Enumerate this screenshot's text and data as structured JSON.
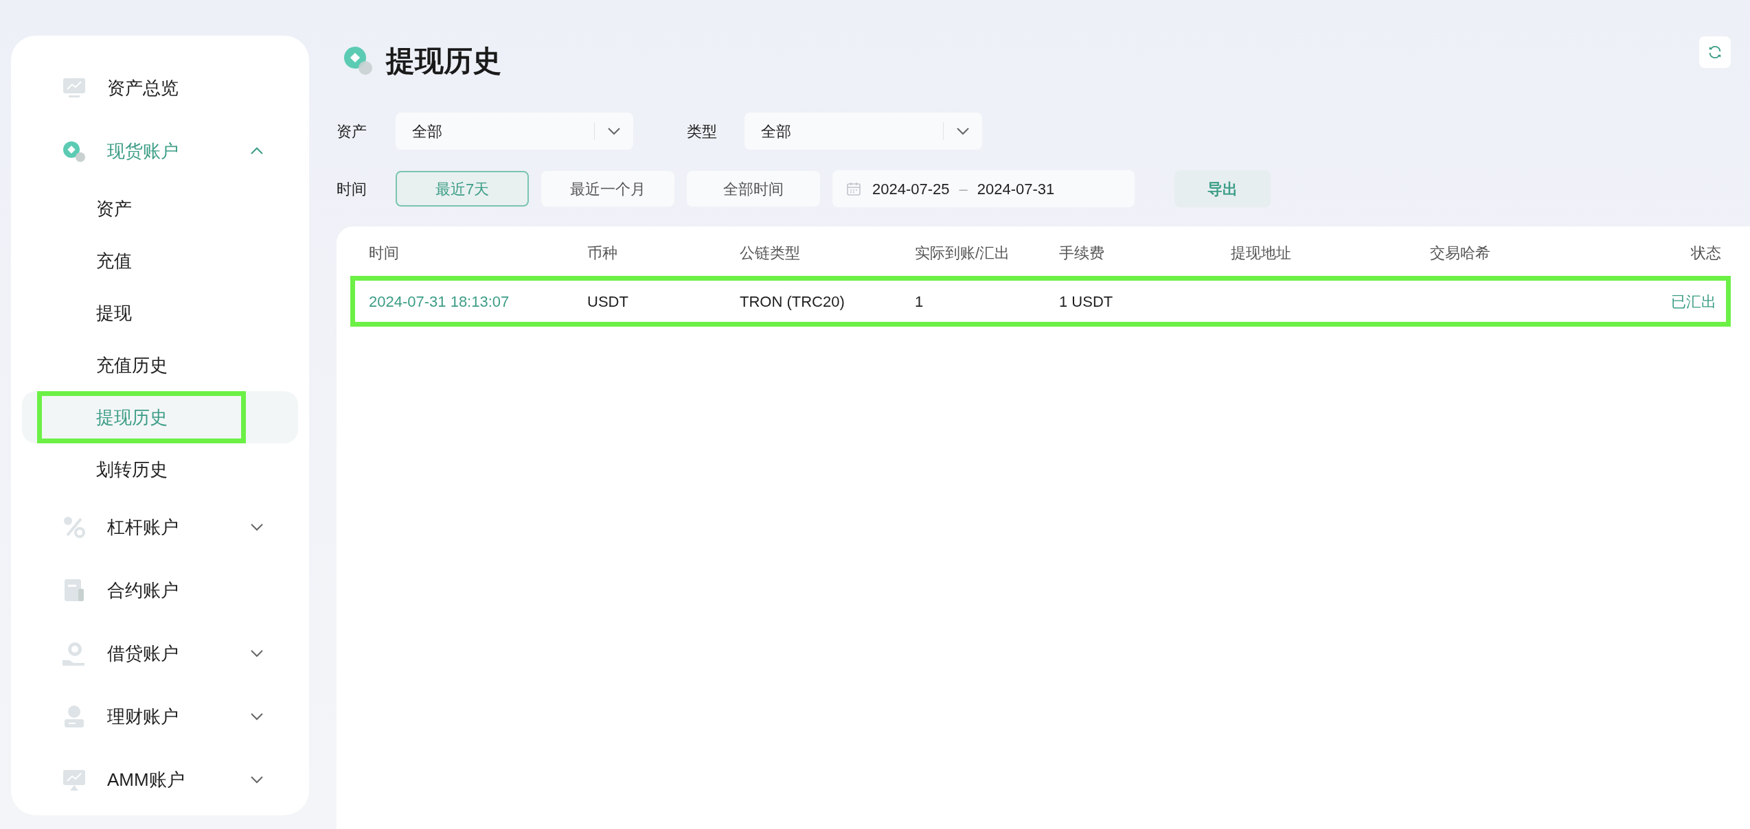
{
  "sidebar": {
    "items": [
      {
        "label": "资产总览",
        "kind": "link",
        "selected": false
      },
      {
        "label": "现货账户",
        "kind": "group",
        "selected": true,
        "expanded": true,
        "children": [
          {
            "label": "资产",
            "selected": false,
            "highlight": false
          },
          {
            "label": "充值",
            "selected": false,
            "highlight": false
          },
          {
            "label": "提现",
            "selected": false,
            "highlight": false
          },
          {
            "label": "充值历史",
            "selected": false,
            "highlight": false
          },
          {
            "label": "提现历史",
            "selected": true,
            "highlight": true
          },
          {
            "label": "划转历史",
            "selected": false,
            "highlight": false
          }
        ]
      },
      {
        "label": "杠杆账户",
        "kind": "group",
        "selected": false,
        "expanded": false
      },
      {
        "label": "合约账户",
        "kind": "link",
        "selected": false
      },
      {
        "label": "借贷账户",
        "kind": "group",
        "selected": false,
        "expanded": false
      },
      {
        "label": "理财账户",
        "kind": "group",
        "selected": false,
        "expanded": false
      },
      {
        "label": "AMM账户",
        "kind": "group",
        "selected": false,
        "expanded": false
      }
    ]
  },
  "page": {
    "title": "提现历史"
  },
  "filters": {
    "selects": [
      {
        "label": "资产",
        "value": "全部"
      },
      {
        "label": "类型",
        "value": "全部"
      }
    ],
    "time_label": "时间",
    "ranges": [
      {
        "label": "最近7天",
        "selected": true
      },
      {
        "label": "最近一个月",
        "selected": false
      },
      {
        "label": "全部时间",
        "selected": false
      }
    ],
    "date_range": {
      "start": "2024-07-25",
      "separator": "–",
      "end": "2024-07-31"
    },
    "export": "导出"
  },
  "table": {
    "columns": [
      "时间",
      "币种",
      "公链类型",
      "实际到账/汇出",
      "手续费",
      "提现地址",
      "交易哈希",
      "状态"
    ],
    "rows": [
      {
        "highlight": true,
        "cells": [
          "2024-07-31 18:13:07",
          "USDT",
          "TRON (TRC20)",
          "1",
          "1 USDT",
          "",
          "",
          "已汇出"
        ]
      }
    ]
  }
}
